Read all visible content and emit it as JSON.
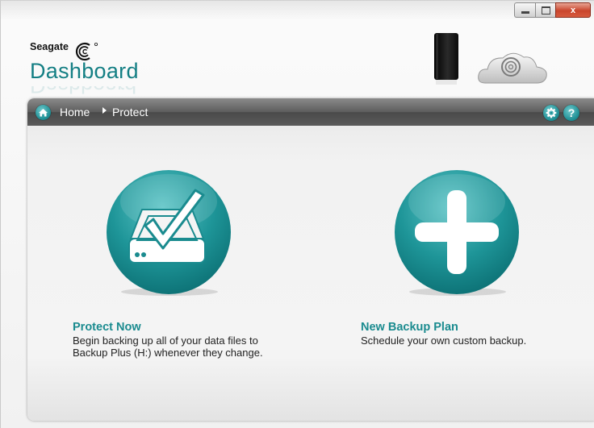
{
  "window": {
    "close_glyph": "x"
  },
  "header": {
    "brand": "Seagate",
    "app_title": "Dashboard"
  },
  "breadcrumb": {
    "home": "Home",
    "current": "Protect"
  },
  "toolbar": {
    "help_glyph": "?"
  },
  "actions": [
    {
      "title": "Protect Now",
      "description": "Begin backing up all of your data files to Backup Plus (H:) whenever they change.",
      "icon": "drive-check-icon"
    },
    {
      "title": "New Backup Plan",
      "description": "Schedule your own custom backup.",
      "icon": "plus-icon"
    }
  ],
  "colors": {
    "accent": "#1a8b8f",
    "title": "#147f84",
    "close": "#c9452c"
  }
}
